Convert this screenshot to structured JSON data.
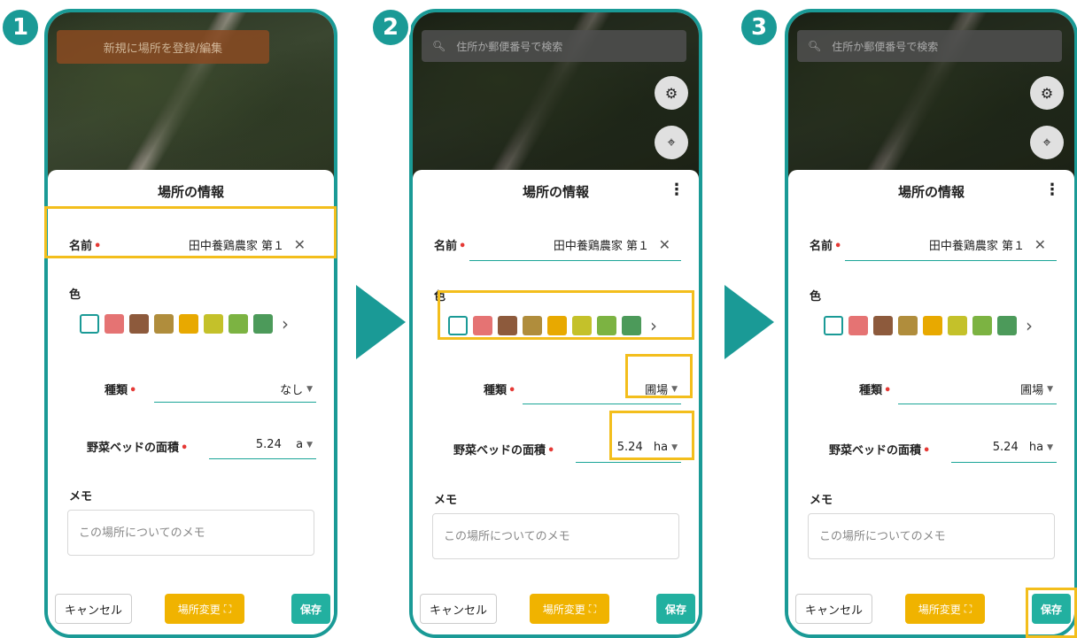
{
  "steps": [
    "1",
    "2",
    "3"
  ],
  "panel1": {
    "banner": "新規に場所を登録/編集",
    "title": "場所の情報",
    "name_label": "名前",
    "name_value": "田中養鶏農家 第１",
    "color_label": "色",
    "type_label": "種類",
    "type_value": "なし",
    "area_label": "野菜ベッドの面積",
    "area_value": "5.24",
    "area_unit": "a",
    "memo_label": "メモ",
    "memo_placeholder": "この場所についてのメモ",
    "cancel": "キャンセル",
    "change_place": "場所変更",
    "save": "保存"
  },
  "panel2": {
    "search_placeholder": "住所か郵便番号で検索",
    "title": "場所の情報",
    "name_label": "名前",
    "name_value": "田中養鶏農家 第１",
    "color_label": "色",
    "type_label": "種類",
    "type_value": "圃場",
    "area_label": "野菜ベッドの面積",
    "area_value": "5.24",
    "area_unit": "ha",
    "memo_label": "メモ",
    "memo_placeholder": "この場所についてのメモ",
    "cancel": "キャンセル",
    "change_place": "場所変更",
    "save": "保存"
  },
  "panel3": {
    "search_placeholder": "住所か郵便番号で検索",
    "title": "場所の情報",
    "name_label": "名前",
    "name_value": "田中養鶏農家 第１",
    "color_label": "色",
    "type_label": "種類",
    "type_value": "圃場",
    "area_label": "野菜ベッドの面積",
    "area_value": "5.24",
    "area_unit": "ha",
    "memo_label": "メモ",
    "memo_placeholder": "この場所についてのメモ",
    "cancel": "キャンセル",
    "change_place": "場所変更",
    "save": "保存"
  },
  "colors": {
    "accent": "#1a9a96",
    "highlight": "#f3be1c",
    "swatches": [
      "#e57373",
      "#8d5a3c",
      "#b08d3c",
      "#e8a900",
      "#c4c12a",
      "#7cb342",
      "#4c9a5a"
    ]
  },
  "icons": [
    "search-icon",
    "gear-icon",
    "locate-icon",
    "more-vert-icon",
    "close-icon",
    "chevron-right-icon",
    "caret-down-icon",
    "place-change-icon"
  ]
}
